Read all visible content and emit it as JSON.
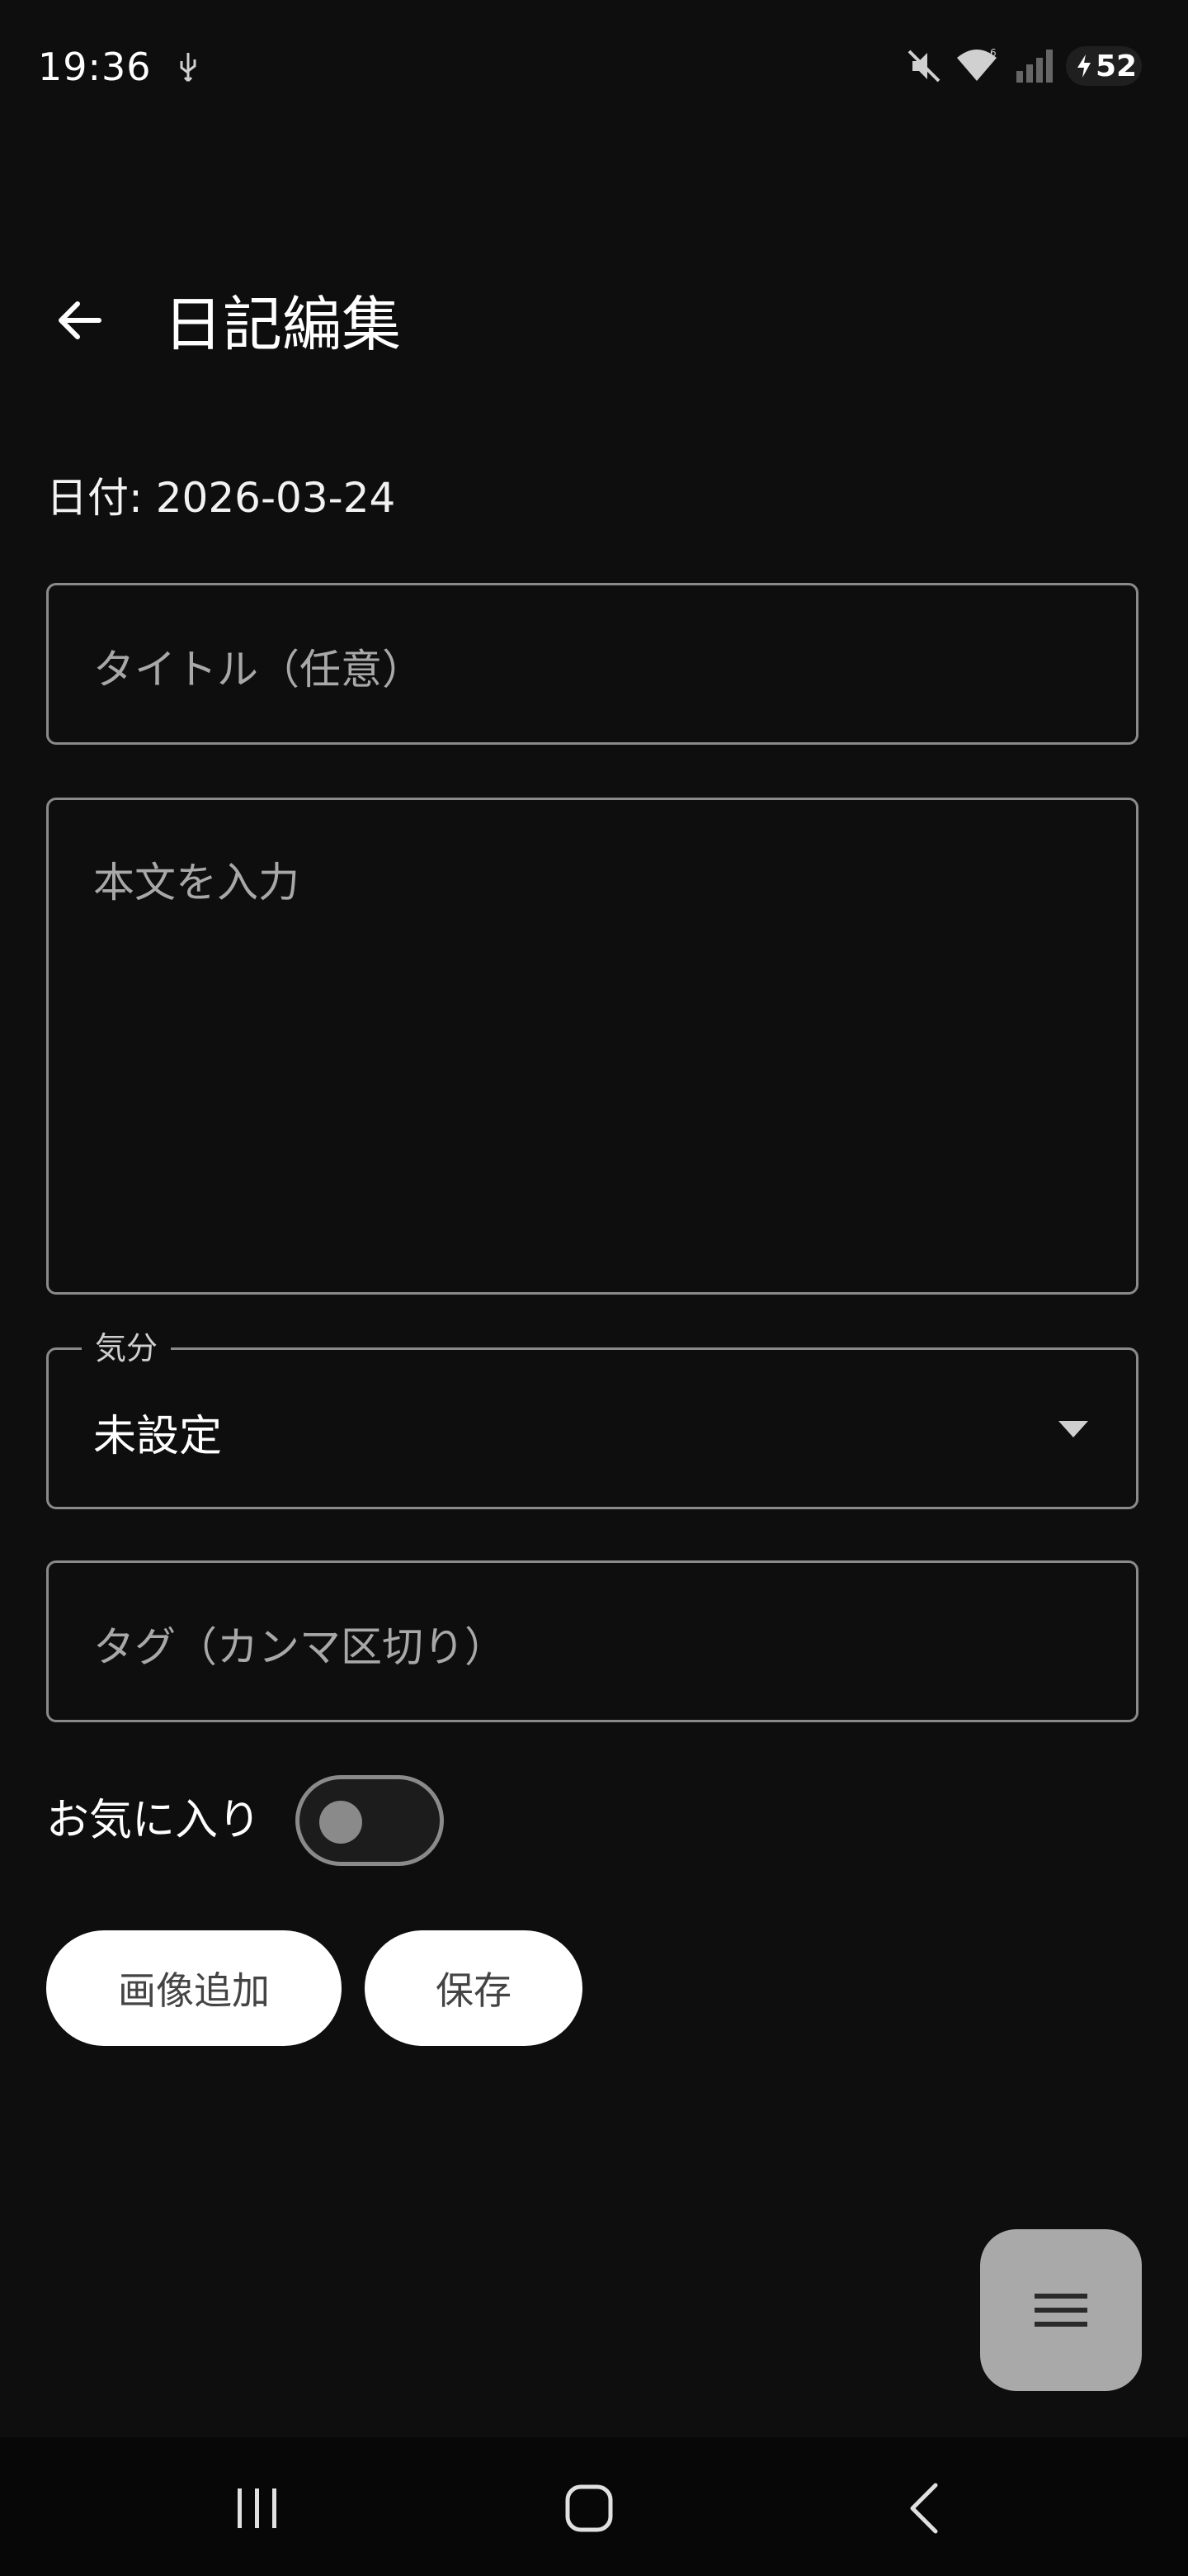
{
  "status_bar": {
    "time": "19:36",
    "battery": "52",
    "icons": [
      "usb-icon",
      "mute-icon",
      "wifi-icon",
      "signal-icon",
      "battery-charging-icon"
    ]
  },
  "app_bar": {
    "title": "日記編集",
    "back_icon": "arrow-back-icon"
  },
  "date_label": "日付: 2026-03-24",
  "form": {
    "title_placeholder": "タイトル（任意）",
    "body_placeholder": "本文を入力",
    "mood_label": "気分",
    "mood_value": "未設定",
    "tags_placeholder": "タグ（カンマ区切り）",
    "favorite_label": "お気に入り",
    "favorite_on": false
  },
  "buttons": {
    "add_image": "画像追加",
    "save": "保存"
  },
  "fab": {
    "icon": "menu-icon"
  },
  "nav_bar": {
    "icons": [
      "recents-icon",
      "home-icon",
      "back-icon"
    ]
  },
  "colors": {
    "background": "#0e0e0e",
    "outline": "#8a8a8a",
    "button_bg": "#ffffff",
    "fab_bg": "#a9a9a9"
  }
}
